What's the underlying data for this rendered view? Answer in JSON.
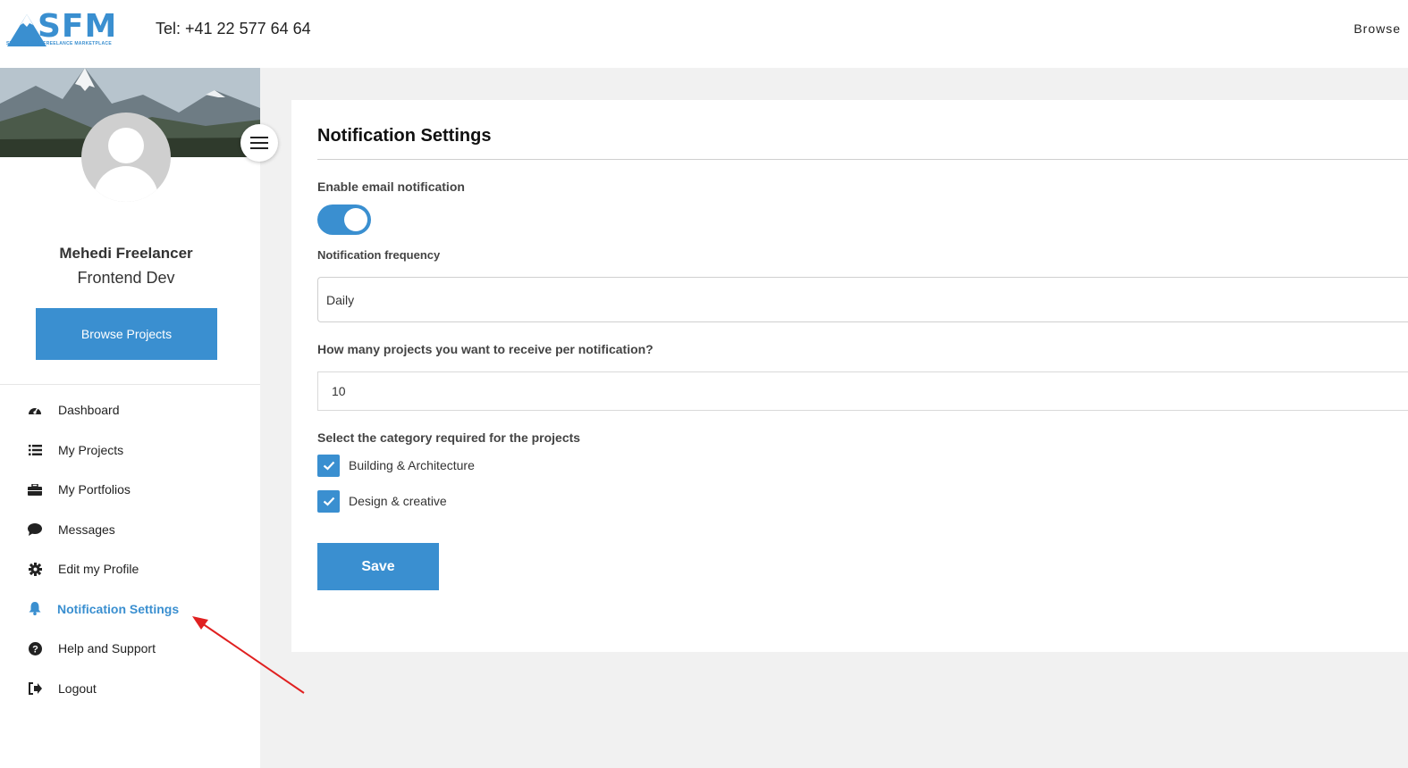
{
  "header": {
    "logo_text": "SFM",
    "logo_tagline": "SWITZERLAND FREELANCE MARKETPLACE",
    "phone": "Tel: +41 22 577 64 64",
    "browse_link": "Browse"
  },
  "profile": {
    "name": "Mehedi Freelancer",
    "role": "Frontend Dev",
    "browse_button": "Browse Projects"
  },
  "sidebar": {
    "items": [
      {
        "label": "Dashboard",
        "icon": "dashboard-icon"
      },
      {
        "label": "My Projects",
        "icon": "list-icon"
      },
      {
        "label": "My Portfolios",
        "icon": "briefcase-icon"
      },
      {
        "label": "Messages",
        "icon": "chat-bubble-icon"
      },
      {
        "label": "Edit my Profile",
        "icon": "gear-icon"
      },
      {
        "label": "Notification Settings",
        "icon": "bell-icon",
        "active": true
      },
      {
        "label": "Help and Support",
        "icon": "question-circle-icon"
      },
      {
        "label": "Logout",
        "icon": "logout-icon"
      }
    ]
  },
  "settings": {
    "title": "Notification Settings",
    "email_label": "Enable email notification",
    "email_enabled": true,
    "frequency_label": "Notification frequency",
    "frequency_value": "Daily",
    "count_label": "How many projects you want to receive per notification?",
    "count_value": "10",
    "category_label": "Select the category required for the projects",
    "categories": [
      {
        "label": "Building & Architecture",
        "checked": true
      },
      {
        "label": "Design & creative",
        "checked": true
      }
    ],
    "save_label": "Save"
  },
  "colors": {
    "accent": "#3a8fd0",
    "annotation_arrow": "#e02020"
  }
}
